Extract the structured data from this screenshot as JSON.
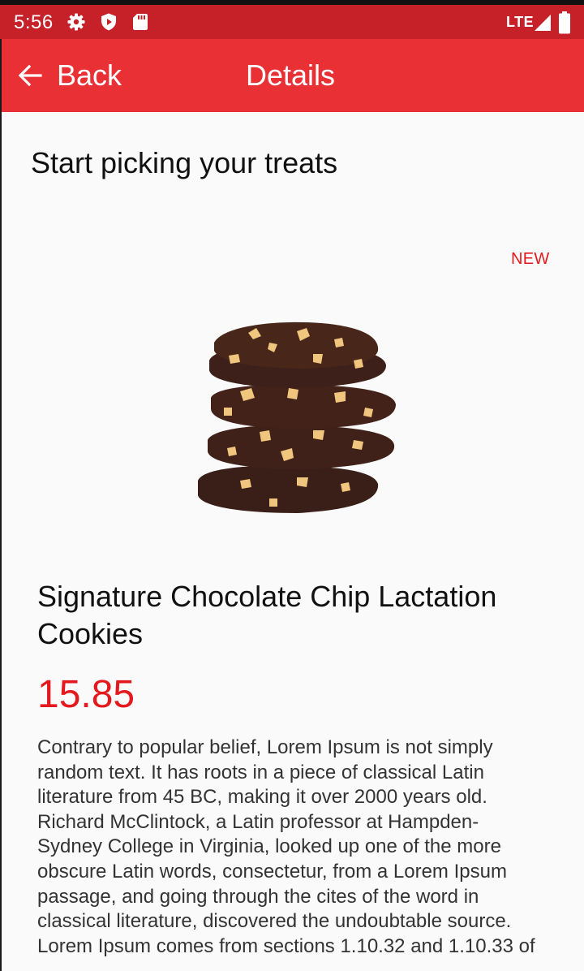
{
  "status_bar": {
    "time": "5:56",
    "network": "LTE",
    "icons": [
      "settings-icon",
      "shield-icon",
      "sd-card-icon",
      "signal-icon",
      "battery-icon"
    ]
  },
  "app_bar": {
    "back_label": "Back",
    "title": "Details"
  },
  "content": {
    "heading": "Start picking your treats",
    "badge": "NEW",
    "product_name": "Signature Chocolate Chip Lactation Cookies",
    "price": "15.85",
    "description": "Contrary to popular belief, Lorem Ipsum is not simply random text. It has roots in a piece of classical Latin literature from 45 BC, making it over 2000 years old. Richard McClintock, a Latin professor at Hampden-Sydney College in Virginia, looked up one of the more obscure Latin words, consectetur, from a Lorem Ipsum passage, and going through the cites of the word in classical literature, discovered the undoubtable source. Lorem Ipsum comes from sections 1.10.32 and 1.10.33 of"
  },
  "colors": {
    "status_bar": "#c62128",
    "app_bar": "#e83035",
    "accent": "#e3191e",
    "background": "#fafafa"
  }
}
